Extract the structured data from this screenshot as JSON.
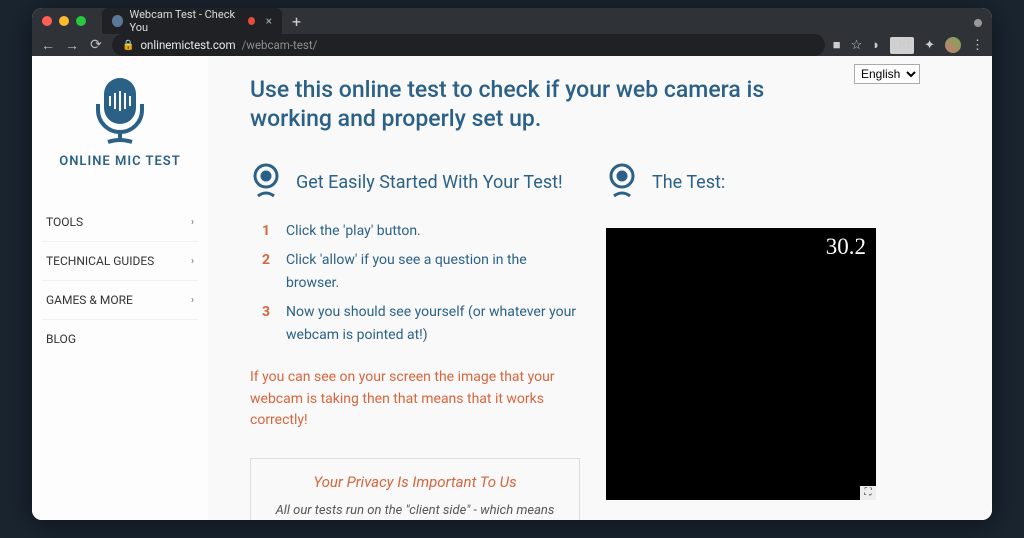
{
  "browser": {
    "tab_title": "Webcam Test - Check You",
    "url_host": "onlinemictest.com",
    "url_path": "/webcam-test/",
    "ext_off": "Off"
  },
  "lang": {
    "selected": "English"
  },
  "sidebar": {
    "logo_text": "ONLINE MIC TEST",
    "items": [
      {
        "label": "TOOLS",
        "has_sub": true
      },
      {
        "label": "TECHNICAL GUIDES",
        "has_sub": true
      },
      {
        "label": "GAMES & MORE",
        "has_sub": true
      },
      {
        "label": "BLOG",
        "has_sub": false
      }
    ]
  },
  "main": {
    "heading": "Use this online test to check if your web camera is working and properly set up.",
    "started_title": "Get Easily Started With Your Test!",
    "steps": [
      "Click the 'play' button.",
      "Click 'allow' if you see a question in the browser.",
      "Now you should see yourself (or whatever your webcam is pointed at!)"
    ],
    "success_note": "If you can see on your screen the image that your webcam is taking then that means that it works correctly!",
    "privacy_title": "Your Privacy Is Important To Us",
    "privacy_body": "All our tests run on the \"client side\" - which means that we do not and can not see or record",
    "test_title": "The Test:",
    "fps": "30.2"
  }
}
